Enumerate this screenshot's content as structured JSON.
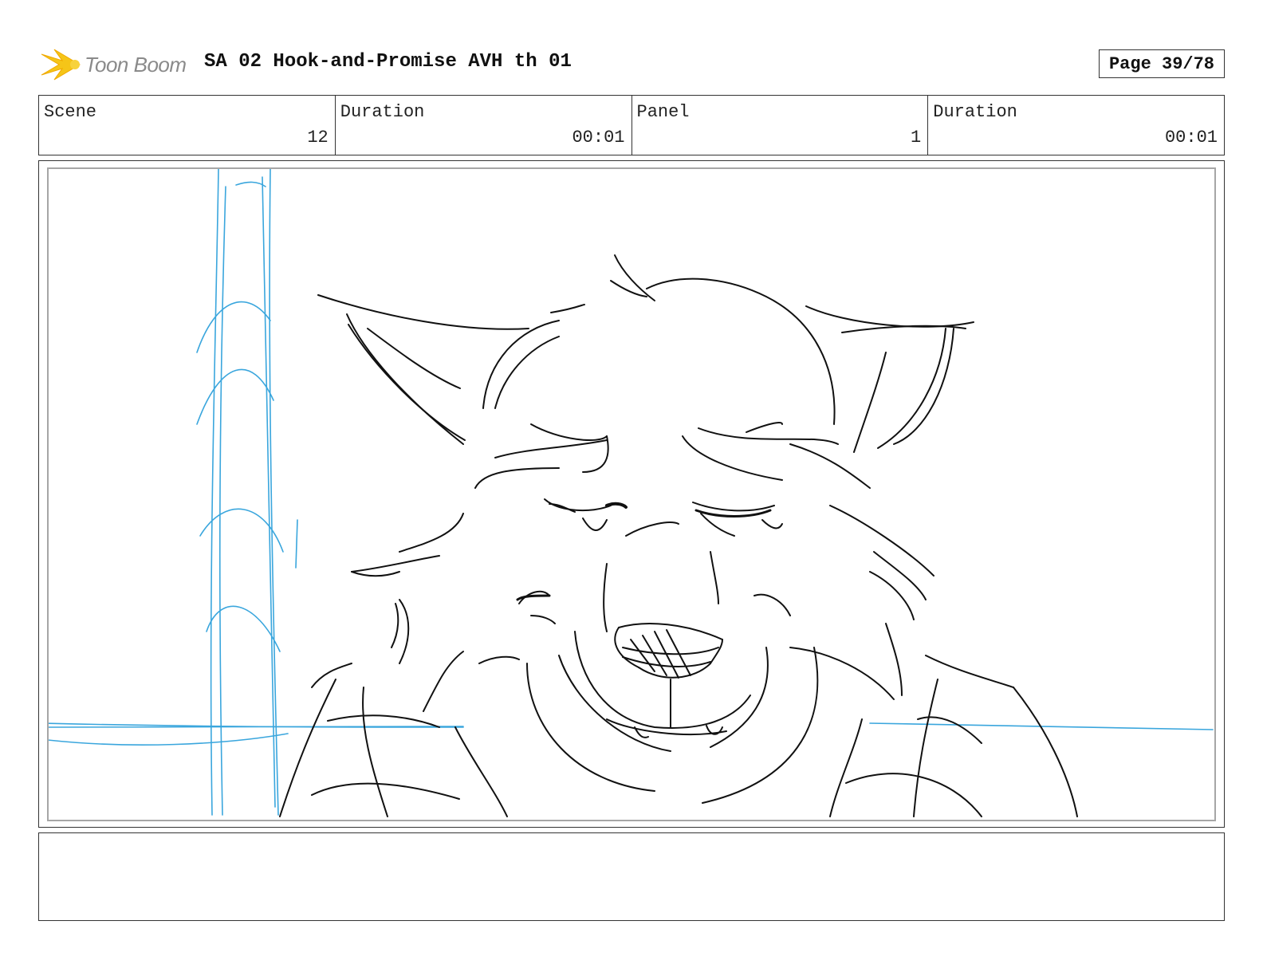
{
  "header": {
    "logo_text": "Toon Boom",
    "title": "SA 02 Hook-and-Promise AVH th 01",
    "page": "Page 39/78"
  },
  "info": {
    "scene_label": "Scene",
    "scene_value": "12",
    "scene_duration_label": "Duration",
    "scene_duration_value": "00:01",
    "panel_label": "Panel",
    "panel_value": "1",
    "panel_duration_label": "Duration",
    "panel_duration_value": "00:01"
  },
  "colors": {
    "sketch_line": "#111111",
    "guide_line": "#3aa6dd",
    "logo_star": "#f5c518"
  },
  "notes": ""
}
